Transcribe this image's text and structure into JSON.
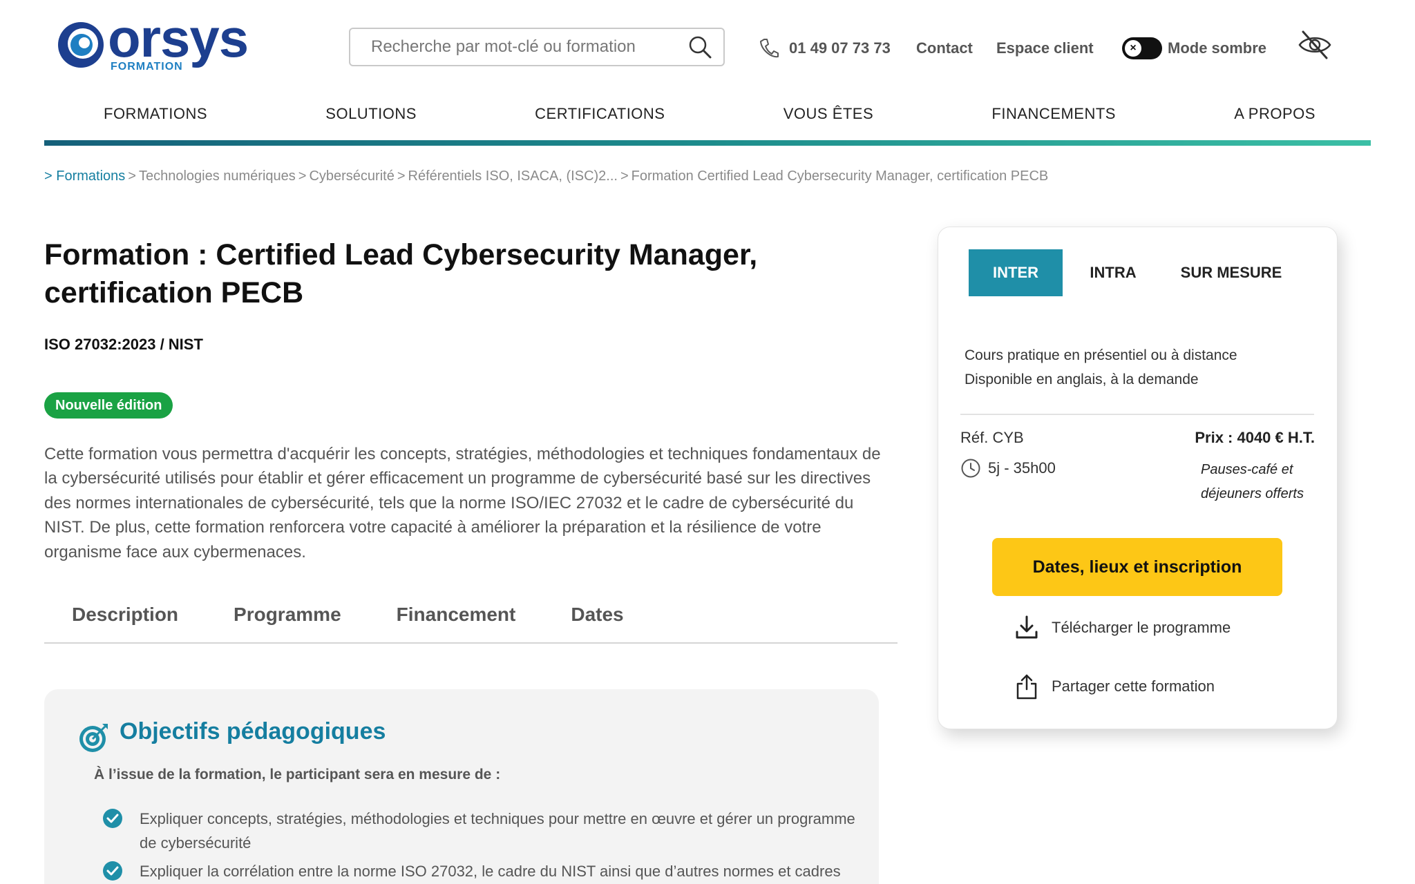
{
  "header": {
    "logo_text": "orsys",
    "logo_sub": "FORMATION",
    "search_placeholder": "Recherche par mot-clé ou formation",
    "phone": "01 49 07 73 73",
    "contact": "Contact",
    "client_space": "Espace client",
    "dark_mode": "Mode sombre"
  },
  "nav": {
    "items": [
      {
        "label": "FORMATIONS"
      },
      {
        "label": "SOLUTIONS"
      },
      {
        "label": "CERTIFICATIONS"
      },
      {
        "label": "VOUS ÊTES"
      },
      {
        "label": "FINANCEMENTS"
      },
      {
        "label": "A PROPOS"
      }
    ],
    "accent_colors": [
      "#15607a",
      "#3bbfa5"
    ]
  },
  "breadcrumb": {
    "items": [
      "> Formations",
      "Technologies numériques",
      "Cybersécurité",
      "Référentiels ISO, ISACA, (ISC)2...",
      "Formation Certified Lead Cybersecurity Manager, certification PECB"
    ]
  },
  "course": {
    "title": "Formation : Certified Lead Cybersecurity Manager, certification PECB",
    "subtitle": "ISO 27032:2023 / NIST",
    "badge": "Nouvelle édition",
    "intro": "Cette formation vous permettra d'acquérir les concepts, stratégies, méthodologies et techniques fondamentaux de la cybersécurité utilisés pour établir et gérer efficacement un programme de cybersécurité basé sur les directives des normes internationales de cybersécurité, tels que la norme ISO/IEC 27032 et le cadre de cybersécurité du NIST. De plus, cette formation renforcera votre capacité à améliorer la préparation et la résilience de votre organisme face aux cybermenaces."
  },
  "tabs": [
    {
      "label": "Description"
    },
    {
      "label": "Programme"
    },
    {
      "label": "Financement"
    },
    {
      "label": "Dates"
    }
  ],
  "objectives": {
    "title": "Objectifs pédagogiques",
    "lead": "À l’issue de la formation, le participant sera en mesure de :",
    "items": [
      "Expliquer concepts, stratégies, méthodologies et techniques pour mettre en œuvre et gérer un programme de cybersécurité",
      "Expliquer la corrélation entre la norme ISO 27032, le cadre du NIST ainsi que d’autres normes et cadres"
    ]
  },
  "card": {
    "tabs": [
      "INTER",
      "INTRA",
      "SUR MESURE"
    ],
    "active_tab": "INTER",
    "desc_line1": "Cours pratique en présentiel ou à distance",
    "desc_line2": "Disponible en anglais, à la demande",
    "ref": "Réf. CYB",
    "duration": "5j - 35h00",
    "price": "Prix : 4040 € H.T.",
    "extras": "Pauses-café et déjeuners offerts",
    "cta": "Dates, lieux et inscription",
    "download": "Télécharger le programme",
    "share": "Partager cette formation",
    "colors": {
      "tab_active": "#1f8fa8",
      "cta": "#fdc716",
      "badge": "#1aa244"
    }
  }
}
